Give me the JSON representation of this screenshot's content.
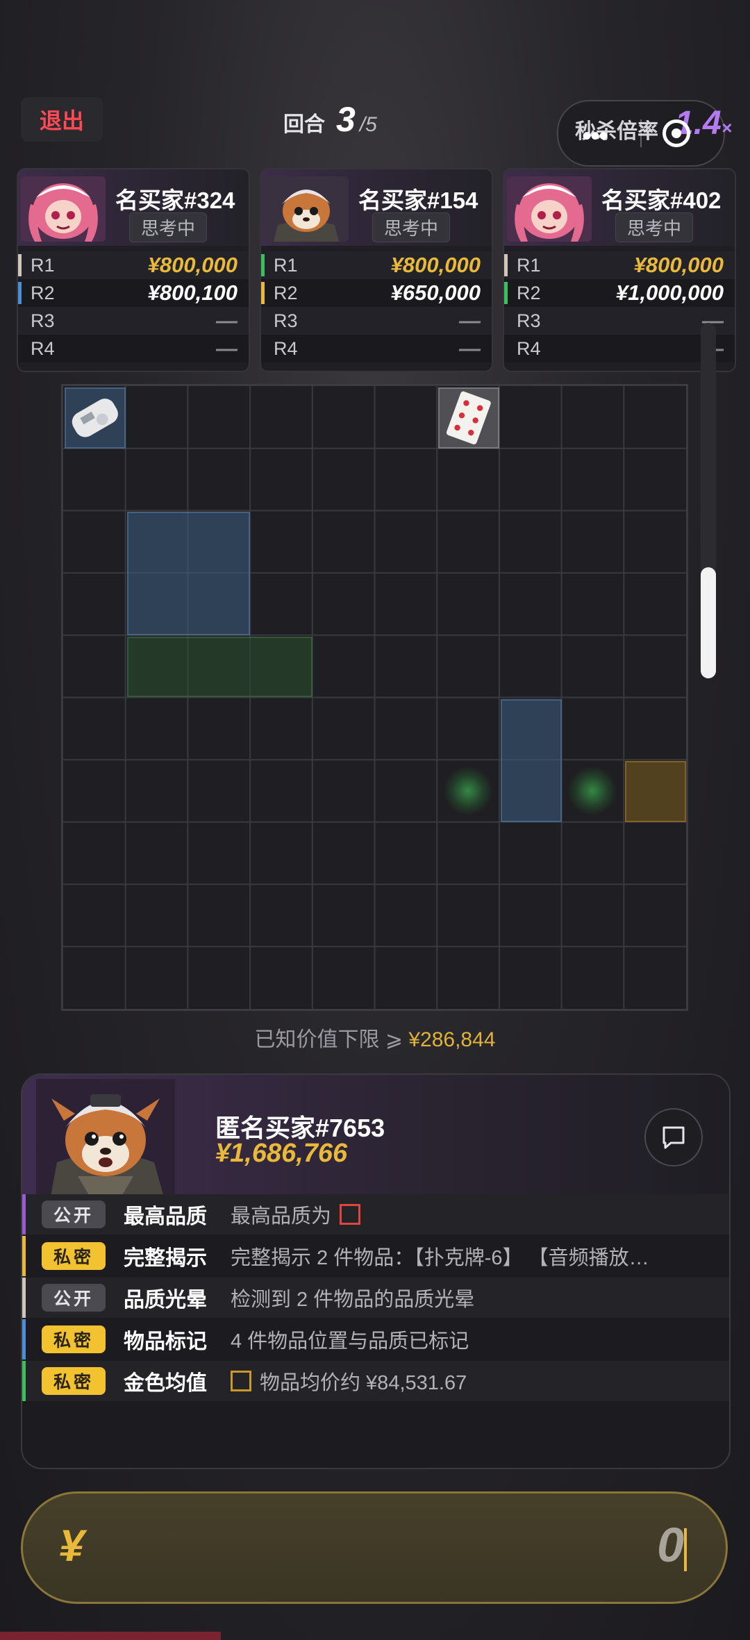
{
  "header": {
    "exit_label": "退出",
    "round_label": "回合",
    "round_current": "3",
    "round_total": "/5",
    "kill_rate_label": "秒杀倍率",
    "kill_rate_value": "1.4",
    "kill_rate_suffix": "×"
  },
  "bidders": [
    {
      "name": "名买家#324",
      "status": "思考中",
      "rounds": [
        {
          "label": "R1",
          "value": "¥800,000",
          "color": "#cfc8b8"
        },
        {
          "label": "R2",
          "value": "¥800,100",
          "color": "#4a90d9"
        },
        {
          "label": "R3",
          "value": "—"
        },
        {
          "label": "R4",
          "value": "—"
        }
      ]
    },
    {
      "name": "名买家#154",
      "status": "思考中",
      "rounds": [
        {
          "label": "R1",
          "value": "¥800,000",
          "color": "#3cc05a"
        },
        {
          "label": "R2",
          "value": "¥650,000",
          "color": "#e8b93a"
        },
        {
          "label": "R3",
          "value": "—"
        },
        {
          "label": "R4",
          "value": "—"
        }
      ]
    },
    {
      "name": "名买家#402",
      "status": "思考中",
      "rounds": [
        {
          "label": "R1",
          "value": "¥800,000",
          "color": "#cfc8b8"
        },
        {
          "label": "R2",
          "value": "¥1,000,000",
          "color": "#3cc05a"
        },
        {
          "label": "R3",
          "value": "—"
        },
        {
          "label": "R4",
          "value": "—"
        }
      ]
    }
  ],
  "grid": {
    "cols": 10,
    "rows": 10,
    "scroll_position": 0.7,
    "items": [
      {
        "type": "audio-player",
        "quality": "blue",
        "col": 0,
        "row": 0,
        "w": 1,
        "h": 1
      },
      {
        "type": "playing-card",
        "quality": "gray",
        "col": 6,
        "row": 0,
        "w": 1,
        "h": 1
      },
      {
        "type": "unknown",
        "quality": "blue",
        "col": 1,
        "row": 2,
        "w": 2,
        "h": 2
      },
      {
        "type": "unknown",
        "quality": "green",
        "col": 1,
        "row": 4,
        "w": 3,
        "h": 1
      },
      {
        "type": "unknown",
        "quality": "blue",
        "col": 7,
        "row": 5,
        "w": 1,
        "h": 2
      },
      {
        "type": "unknown",
        "quality": "gold",
        "col": 9,
        "row": 6,
        "w": 1,
        "h": 1
      }
    ],
    "glows": [
      {
        "col": 6,
        "row": 6,
        "color": "green"
      },
      {
        "col": 8,
        "row": 6,
        "color": "green"
      }
    ]
  },
  "known_value": {
    "label": "已知价值下限 ⩾",
    "value": "¥286,844"
  },
  "buyer": {
    "name": "匿名买家#7653",
    "value": "¥1,686,766"
  },
  "clues": [
    {
      "tag": "公开",
      "tag_type": "public",
      "name": "最高品质",
      "desc": "最高品质为",
      "bar_color": "#9a5ad0"
    },
    {
      "tag": "私密",
      "tag_type": "private",
      "name": "完整揭示",
      "desc": "完整揭示 2 件物品：【扑克牌-6】 【音频播放…",
      "bar_color": "#e8b93a"
    },
    {
      "tag": "公开",
      "tag_type": "public",
      "name": "品质光晕",
      "desc": "检测到 2 件物品的品质光晕",
      "bar_color": "#cfc8b8"
    },
    {
      "tag": "私密",
      "tag_type": "private",
      "name": "物品标记",
      "desc": "4 件物品位置与品质已标记",
      "bar_color": "#4a90d9"
    },
    {
      "tag": "私密",
      "tag_type": "private",
      "name": "金色均值",
      "desc": "物品均价约 ¥84,531.67",
      "bar_color": "#3cc05a"
    }
  ],
  "bid_input": {
    "currency": "¥",
    "value": "0"
  }
}
